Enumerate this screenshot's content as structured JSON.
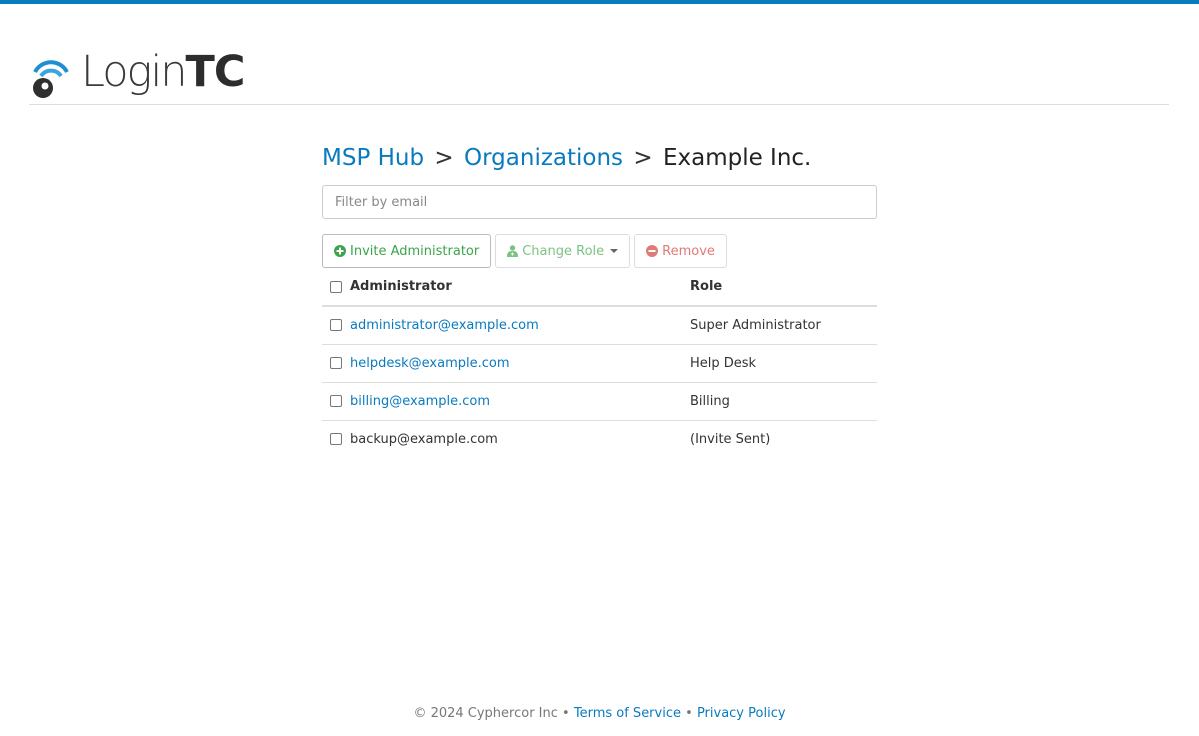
{
  "brand": {
    "logo_light": "Login",
    "logo_bold": "TC",
    "accent_color": "#0a7abf"
  },
  "breadcrumb": {
    "items": [
      "MSP Hub",
      "Organizations",
      "Example Inc."
    ],
    "separator": ">"
  },
  "filter": {
    "placeholder": "Filter by email",
    "value": ""
  },
  "toolbar": {
    "invite_label": "Invite Administrator",
    "invite_icon": "plus-circle-icon",
    "change_role_label": "Change Role",
    "change_role_icon": "user-md-icon",
    "remove_label": "Remove",
    "remove_icon": "minus-circle-icon"
  },
  "table": {
    "headers": [
      "Administrator",
      "Role"
    ],
    "rows": [
      {
        "email": "administrator@example.com",
        "role": "Super Administrator",
        "link": true
      },
      {
        "email": "helpdesk@example.com",
        "role": "Help Desk",
        "link": true
      },
      {
        "email": "billing@example.com",
        "role": "Billing",
        "link": true
      },
      {
        "email": "backup@example.com",
        "role": "(Invite Sent)",
        "link": false
      }
    ]
  },
  "footer": {
    "copyright": "© 2024 Cyphercor Inc",
    "bullet": "•",
    "terms": "Terms of Service",
    "privacy": "Privacy Policy"
  }
}
